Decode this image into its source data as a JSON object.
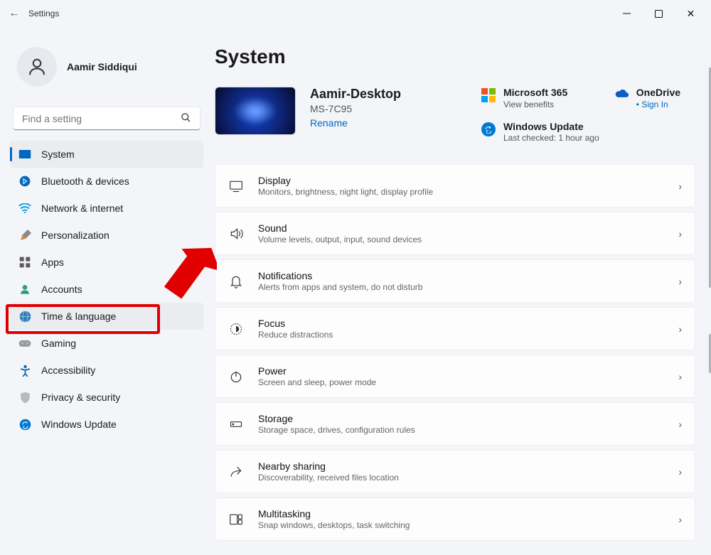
{
  "window": {
    "title": "Settings"
  },
  "user": {
    "name": "Aamir Siddiqui"
  },
  "search": {
    "placeholder": "Find a setting"
  },
  "nav": {
    "items": [
      {
        "label": "System"
      },
      {
        "label": "Bluetooth & devices"
      },
      {
        "label": "Network & internet"
      },
      {
        "label": "Personalization"
      },
      {
        "label": "Apps"
      },
      {
        "label": "Accounts"
      },
      {
        "label": "Time & language"
      },
      {
        "label": "Gaming"
      },
      {
        "label": "Accessibility"
      },
      {
        "label": "Privacy & security"
      },
      {
        "label": "Windows Update"
      }
    ]
  },
  "page": {
    "title": "System"
  },
  "device": {
    "name": "Aamir-Desktop",
    "model": "MS-7C95",
    "rename": "Rename"
  },
  "topcards": {
    "ms365": {
      "title": "Microsoft 365",
      "sub": "View benefits"
    },
    "onedrive": {
      "title": "OneDrive",
      "sub": "Sign In"
    },
    "update": {
      "title": "Windows Update",
      "sub": "Last checked: 1 hour ago"
    }
  },
  "settings": [
    {
      "title": "Display",
      "sub": "Monitors, brightness, night light, display profile"
    },
    {
      "title": "Sound",
      "sub": "Volume levels, output, input, sound devices"
    },
    {
      "title": "Notifications",
      "sub": "Alerts from apps and system, do not disturb"
    },
    {
      "title": "Focus",
      "sub": "Reduce distractions"
    },
    {
      "title": "Power",
      "sub": "Screen and sleep, power mode"
    },
    {
      "title": "Storage",
      "sub": "Storage space, drives, configuration rules"
    },
    {
      "title": "Nearby sharing",
      "sub": "Discoverability, received files location"
    },
    {
      "title": "Multitasking",
      "sub": "Snap windows, desktops, task switching"
    }
  ]
}
